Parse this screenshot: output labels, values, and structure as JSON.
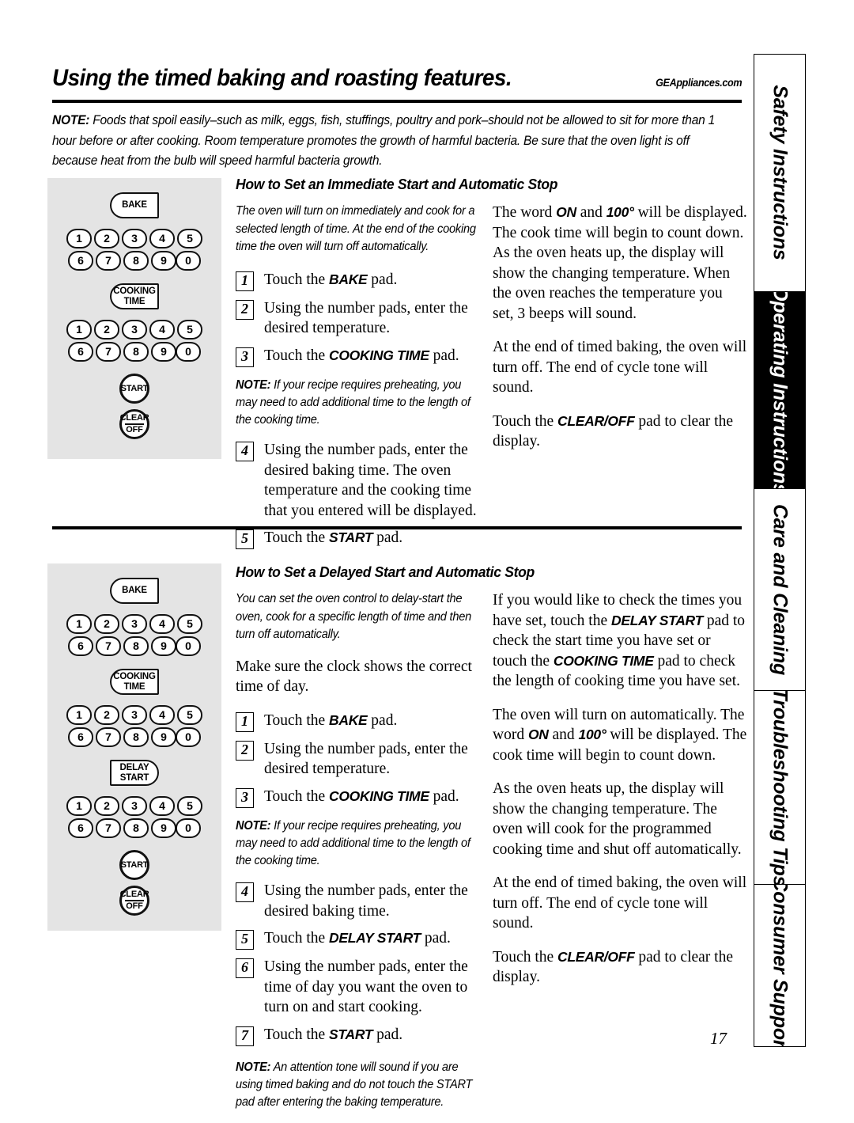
{
  "header": {
    "title": "Using the timed baking and roasting features.",
    "site": "GEAppliances.com"
  },
  "top_note": {
    "label": "NOTE:",
    "text": " Foods that spoil easily–such as milk, eggs, fish, stuffings, poultry and pork–should not be allowed to sit for more than 1 hour before or after cooking. Room temperature promotes the growth of harmful bacteria. Be sure that the oven light is off because heat from the bulb will speed harmful bacteria growth."
  },
  "sections": [
    {
      "heading": "How to Set an Immediate Start and Automatic Stop",
      "intro": "The oven will turn on immediately and cook for a selected length of time. At the end of the cooking time the oven will turn off automatically.",
      "steps": [
        {
          "num": "1",
          "text": "Touch the ",
          "bold": "BAKE",
          "tail": " pad."
        },
        {
          "num": "2",
          "text": "Using the number pads, enter the desired temperature.",
          "bold": "",
          "tail": ""
        },
        {
          "num": "3",
          "text": "Touch the ",
          "bold": "COOKING TIME",
          "tail": " pad."
        },
        {
          "num": "4",
          "text": "Using the number pads, enter the desired baking time. The oven temperature and the cooking time that you entered will be displayed.",
          "bold": "",
          "tail": ""
        },
        {
          "num": "5",
          "text": "Touch the ",
          "bold": "START",
          "tail": " pad."
        }
      ],
      "note_after_step3": {
        "label": "NOTE:",
        "text": " If your recipe requires preheating, you may need to add additional time to the length of the cooking time."
      },
      "right_paras": [
        {
          "pre": "The word ",
          "b1": "ON",
          "mid": " and ",
          "b2": "100°",
          "post": " will be displayed. The cook time will begin to count down. As the oven heats up, the display will show the changing temperature. When the oven reaches the temperature you set, 3 beeps will sound."
        },
        {
          "pre": "At the end of timed baking, the oven will turn off. The end of cycle tone will sound.",
          "b1": "",
          "mid": "",
          "b2": "",
          "post": ""
        },
        {
          "pre": "Touch the ",
          "b1": "CLEAR/OFF",
          "mid": " pad to clear the display.",
          "b2": "",
          "post": ""
        }
      ],
      "panel_pads": [
        "BAKE",
        "COOKING TIME",
        "START",
        "CLEAR/OFF"
      ]
    },
    {
      "heading": "How to Set a Delayed Start and Automatic Stop",
      "intro": "You can set the oven control to delay-start the oven, cook for a specific length of time and then turn off automatically.",
      "lead": "Make sure the clock shows the correct time of day.",
      "steps": [
        {
          "num": "1",
          "text": "Touch the ",
          "bold": "BAKE",
          "tail": " pad."
        },
        {
          "num": "2",
          "text": "Using the number pads, enter the desired temperature.",
          "bold": "",
          "tail": ""
        },
        {
          "num": "3",
          "text": "Touch the ",
          "bold": "COOKING TIME",
          "tail": " pad."
        },
        {
          "num": "4",
          "text": "Using the number pads, enter the desired baking time.",
          "bold": "",
          "tail": ""
        },
        {
          "num": "5",
          "text": "Touch the ",
          "bold": "DELAY START",
          "tail": " pad."
        },
        {
          "num": "6",
          "text": "Using the number pads, enter the time of day you want the oven to turn on and start cooking.",
          "bold": "",
          "tail": ""
        },
        {
          "num": "7",
          "text": "Touch the ",
          "bold": "START",
          "tail": " pad."
        }
      ],
      "note_after_step3": {
        "label": "NOTE:",
        "text": " If your recipe requires preheating, you may need to add additional time to the length of the cooking time."
      },
      "note_final": {
        "label": "NOTE:",
        "text": " An attention tone will sound if you are using timed baking and do not touch the START pad after entering the baking temperature."
      },
      "right_paras": [
        {
          "pre": "If you would like to check the times you have set, touch the ",
          "b1": "DELAY START",
          "mid": " pad to check the start time you have set or touch the ",
          "b2": "COOKING TIME",
          "post": " pad to check the length of cooking time you have set."
        },
        {
          "pre": "The oven will turn on automatically. The word ",
          "b1": "ON",
          "mid": " and ",
          "b2": "100°",
          "post": " will be displayed. The cook time will begin to count down."
        },
        {
          "pre": "As the oven heats up, the display will show the changing temperature. The oven will cook for the programmed cooking time and shut off automatically.",
          "b1": "",
          "mid": "",
          "b2": "",
          "post": ""
        },
        {
          "pre": "At the end of timed baking, the oven will turn off. The end of cycle tone will sound.",
          "b1": "",
          "mid": "",
          "b2": "",
          "post": ""
        },
        {
          "pre": "Touch the ",
          "b1": "CLEAR/OFF",
          "mid": " pad to clear the display.",
          "b2": "",
          "post": ""
        }
      ],
      "panel_pads": [
        "BAKE",
        "COOKING TIME",
        "DELAY START",
        "START",
        "CLEAR/OFF"
      ]
    }
  ],
  "keypad": {
    "row1": [
      "1",
      "2",
      "3",
      "4",
      "5"
    ],
    "row2": [
      "6",
      "7",
      "8",
      "9",
      "0"
    ]
  },
  "pads": {
    "bake": "BAKE",
    "cooking_time_line1": "COOKING",
    "cooking_time_line2": "TIME",
    "delay_start_line1": "DELAY",
    "delay_start_line2": "START",
    "start": "START",
    "clear": "CLEAR",
    "off": "OFF"
  },
  "tabs": [
    {
      "label": "Safety Instructions",
      "active": false
    },
    {
      "label": "Operating Instructions",
      "active": true
    },
    {
      "label": "Care and Cleaning",
      "active": false
    },
    {
      "label": "Troubleshooting Tips",
      "active": false
    },
    {
      "label": "Consumer Support",
      "active": false
    }
  ],
  "page_number": "17"
}
